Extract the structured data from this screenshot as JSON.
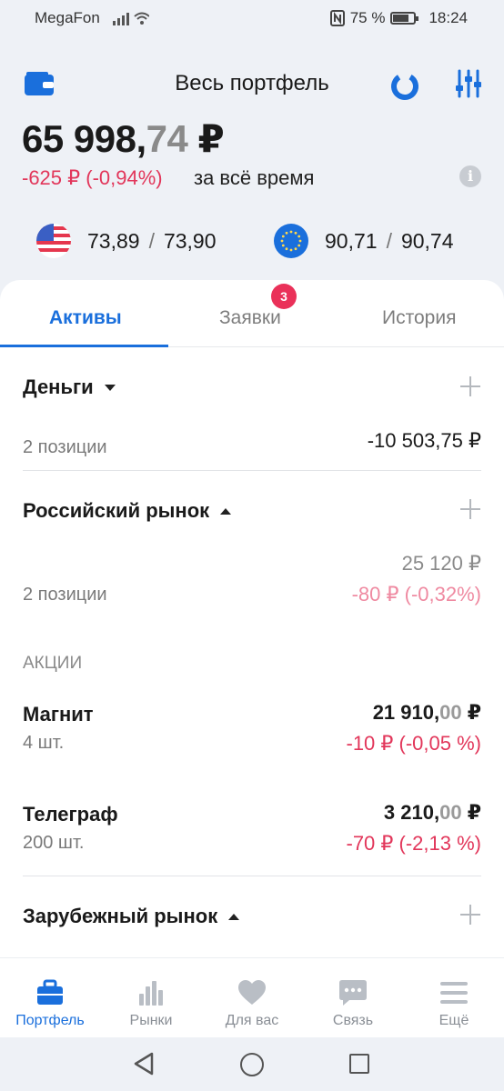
{
  "status_bar": {
    "carrier": "MegaFon",
    "battery": "75 %",
    "battery_level": 0.75,
    "time": "18:24"
  },
  "header": {
    "title": "Весь портфель",
    "total_int": "65 998,",
    "total_dec": "74",
    "total_currency": " ₽",
    "change": "-625 ₽ (-0,94%)",
    "change_label": "за всё время",
    "info_icon": "i",
    "rates": [
      {
        "flag": "us-flag-icon",
        "buy": "73,89",
        "sep": "/",
        "sell": "73,90"
      },
      {
        "flag": "eu-flag-icon",
        "buy": "90,71",
        "sep": "/",
        "sell": "90,74"
      }
    ]
  },
  "tabs": [
    {
      "label": "Активы",
      "active": true
    },
    {
      "label": "Заявки",
      "active": false,
      "badge": "3"
    },
    {
      "label": "История",
      "active": false
    }
  ],
  "money": {
    "title": "Деньги",
    "positions": "2 позиции",
    "amount": "-10 503,75 ₽"
  },
  "russian_market": {
    "title": "Российский рынок",
    "positions": "2 позиции",
    "value": "25 120 ₽",
    "change": "-80 ₽ (-0,32%)"
  },
  "shares_label": "АКЦИИ",
  "assets": [
    {
      "name": "Магнит",
      "qty": "4 шт.",
      "price_int": "21 910,",
      "price_dec": "00",
      "currency": " ₽",
      "change": "-10 ₽ (-0,05 %)"
    },
    {
      "name": "Телеграф",
      "qty": "200 шт.",
      "price_int": "3 210,",
      "price_dec": "00",
      "currency": " ₽",
      "change": "-70 ₽ (-2,13 %)"
    }
  ],
  "foreign_market": {
    "title": "Зарубежный рынок"
  },
  "bottom_nav": [
    {
      "label": "Портфель",
      "icon": "briefcase-icon",
      "active": true
    },
    {
      "label": "Рынки",
      "icon": "bar-chart-icon",
      "active": false
    },
    {
      "label": "Для вас",
      "icon": "heart-icon",
      "active": false
    },
    {
      "label": "Связь",
      "icon": "chat-icon",
      "active": false
    },
    {
      "label": "Ещё",
      "icon": "menu-icon",
      "active": false
    }
  ],
  "colors": {
    "accent": "#1a6fdc",
    "negative": "#e2365a",
    "negative_light": "#ef8aa1",
    "badge": "#ea3159"
  }
}
